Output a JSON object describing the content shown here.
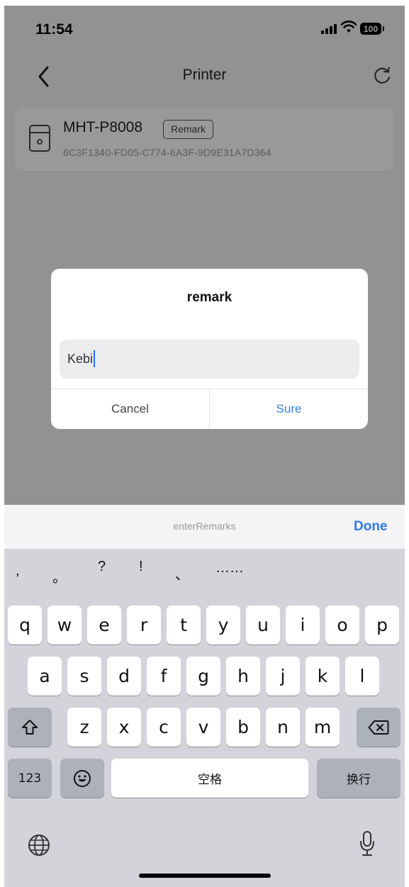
{
  "status_bar": {
    "time": "11:54",
    "battery": "100"
  },
  "nav": {
    "title": "Printer"
  },
  "device": {
    "name": "MHT-P8008",
    "remark_label": "Remark",
    "id": "6C3F1340-FD05-C774-6A3F-9D9E31A7D364"
  },
  "dialog": {
    "title": "remark",
    "input_value": "Kebi",
    "cancel_label": "Cancel",
    "sure_label": "Sure"
  },
  "accessory": {
    "placeholder": "enterRemarks",
    "done_label": "Done"
  },
  "keyboard": {
    "punctuation": [
      ",",
      "。",
      "?",
      "!",
      "、",
      "……"
    ],
    "row1": [
      "q",
      "w",
      "e",
      "r",
      "t",
      "y",
      "u",
      "i",
      "o",
      "p"
    ],
    "row2": [
      "a",
      "s",
      "d",
      "f",
      "g",
      "h",
      "j",
      "k",
      "l"
    ],
    "row3": [
      "z",
      "x",
      "c",
      "v",
      "b",
      "n",
      "m"
    ],
    "numbers_label": "123",
    "space_label": "空格",
    "return_label": "换行"
  },
  "icons": {
    "back": "chevron-left-icon",
    "refresh": "refresh-icon",
    "printer": "printer-icon",
    "shift": "shift-icon",
    "delete": "backspace-icon",
    "emoji": "emoji-icon",
    "globe": "globe-icon",
    "mic": "microphone-icon"
  },
  "colors": {
    "accent": "#3b82e8",
    "done": "#2f7be8",
    "caret": "#2a6df4"
  }
}
